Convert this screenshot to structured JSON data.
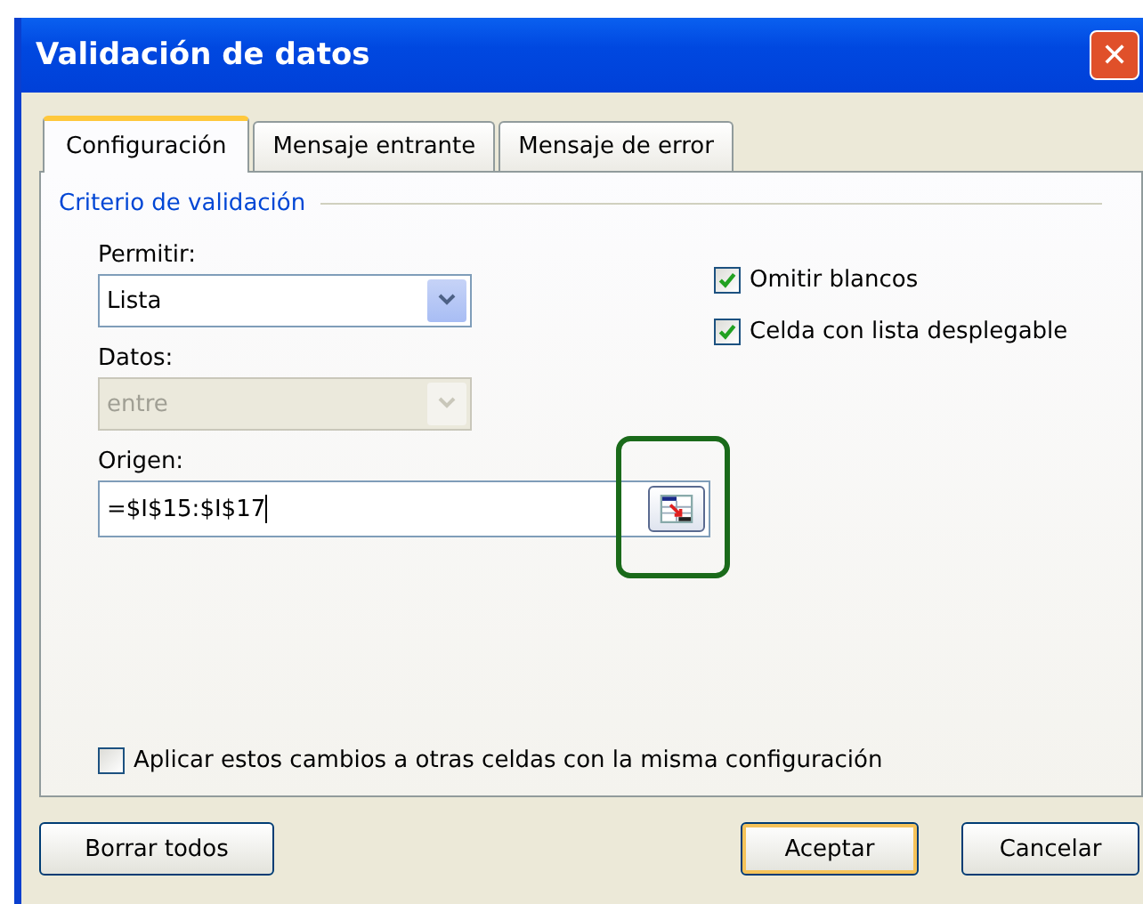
{
  "window": {
    "title": "Validación de datos",
    "close": "✕"
  },
  "tabs": [
    {
      "label": "Configuración",
      "selected": true
    },
    {
      "label": "Mensaje entrante",
      "selected": false
    },
    {
      "label": "Mensaje de error",
      "selected": false
    }
  ],
  "group": {
    "title": "Criterio de validación"
  },
  "permitir": {
    "label": "Permitir:",
    "value": "Lista",
    "disabled": false
  },
  "datos": {
    "label": "Datos:",
    "value": "entre",
    "disabled": true
  },
  "origen": {
    "label": "Origen:",
    "value": "=$I$15:$I$17",
    "highlighted": true
  },
  "options": [
    {
      "label": "Omitir blancos",
      "checked": true
    },
    {
      "label": "Celda con lista desplegable",
      "checked": true
    }
  ],
  "apply_all": {
    "label": "Aplicar estos cambios a otras celdas con la misma configuración",
    "checked": false
  },
  "buttons": [
    {
      "label": "Borrar todos",
      "default": false
    },
    {
      "label": "Aceptar",
      "default": true
    },
    {
      "label": "Cancelar",
      "default": false
    }
  ]
}
